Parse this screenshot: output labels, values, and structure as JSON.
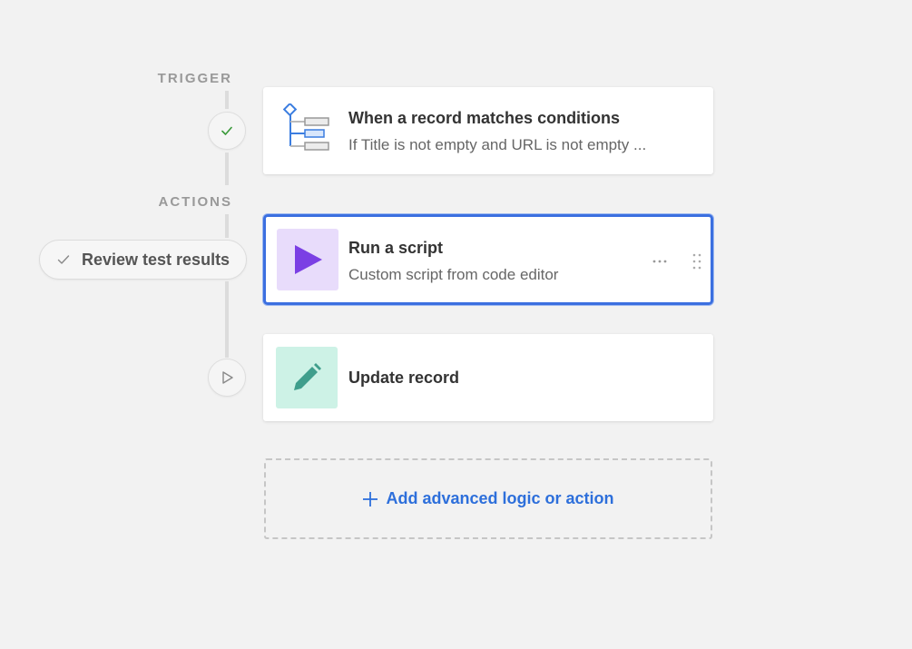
{
  "sections": {
    "trigger_label": "TRIGGER",
    "actions_label": "ACTIONS"
  },
  "trigger": {
    "title": "When a record matches conditions",
    "subtitle": "If Title is not empty and URL is not empty ...",
    "icon": "conditions-tree-icon",
    "status_icon": "check-icon"
  },
  "review_pill": {
    "label": "Review test results",
    "icon": "check-icon"
  },
  "actions": [
    {
      "title": "Run a script",
      "subtitle": "Custom script from code editor",
      "icon": "play-icon",
      "icon_bg": "#e8dcfb",
      "icon_color": "#7b3fe4",
      "selected": true
    },
    {
      "title": "Update record",
      "icon": "pencil-icon",
      "icon_bg": "#cdf2e6",
      "icon_color": "#3f9e8c",
      "status_icon": "play-outline-icon"
    }
  ],
  "add_action": {
    "label": "Add advanced logic or action",
    "icon": "plus-icon"
  },
  "colors": {
    "accent": "#2d6fdb",
    "selection_border": "#3b6fe0",
    "success": "#3a9a3a",
    "background": "#f2f2f2"
  }
}
